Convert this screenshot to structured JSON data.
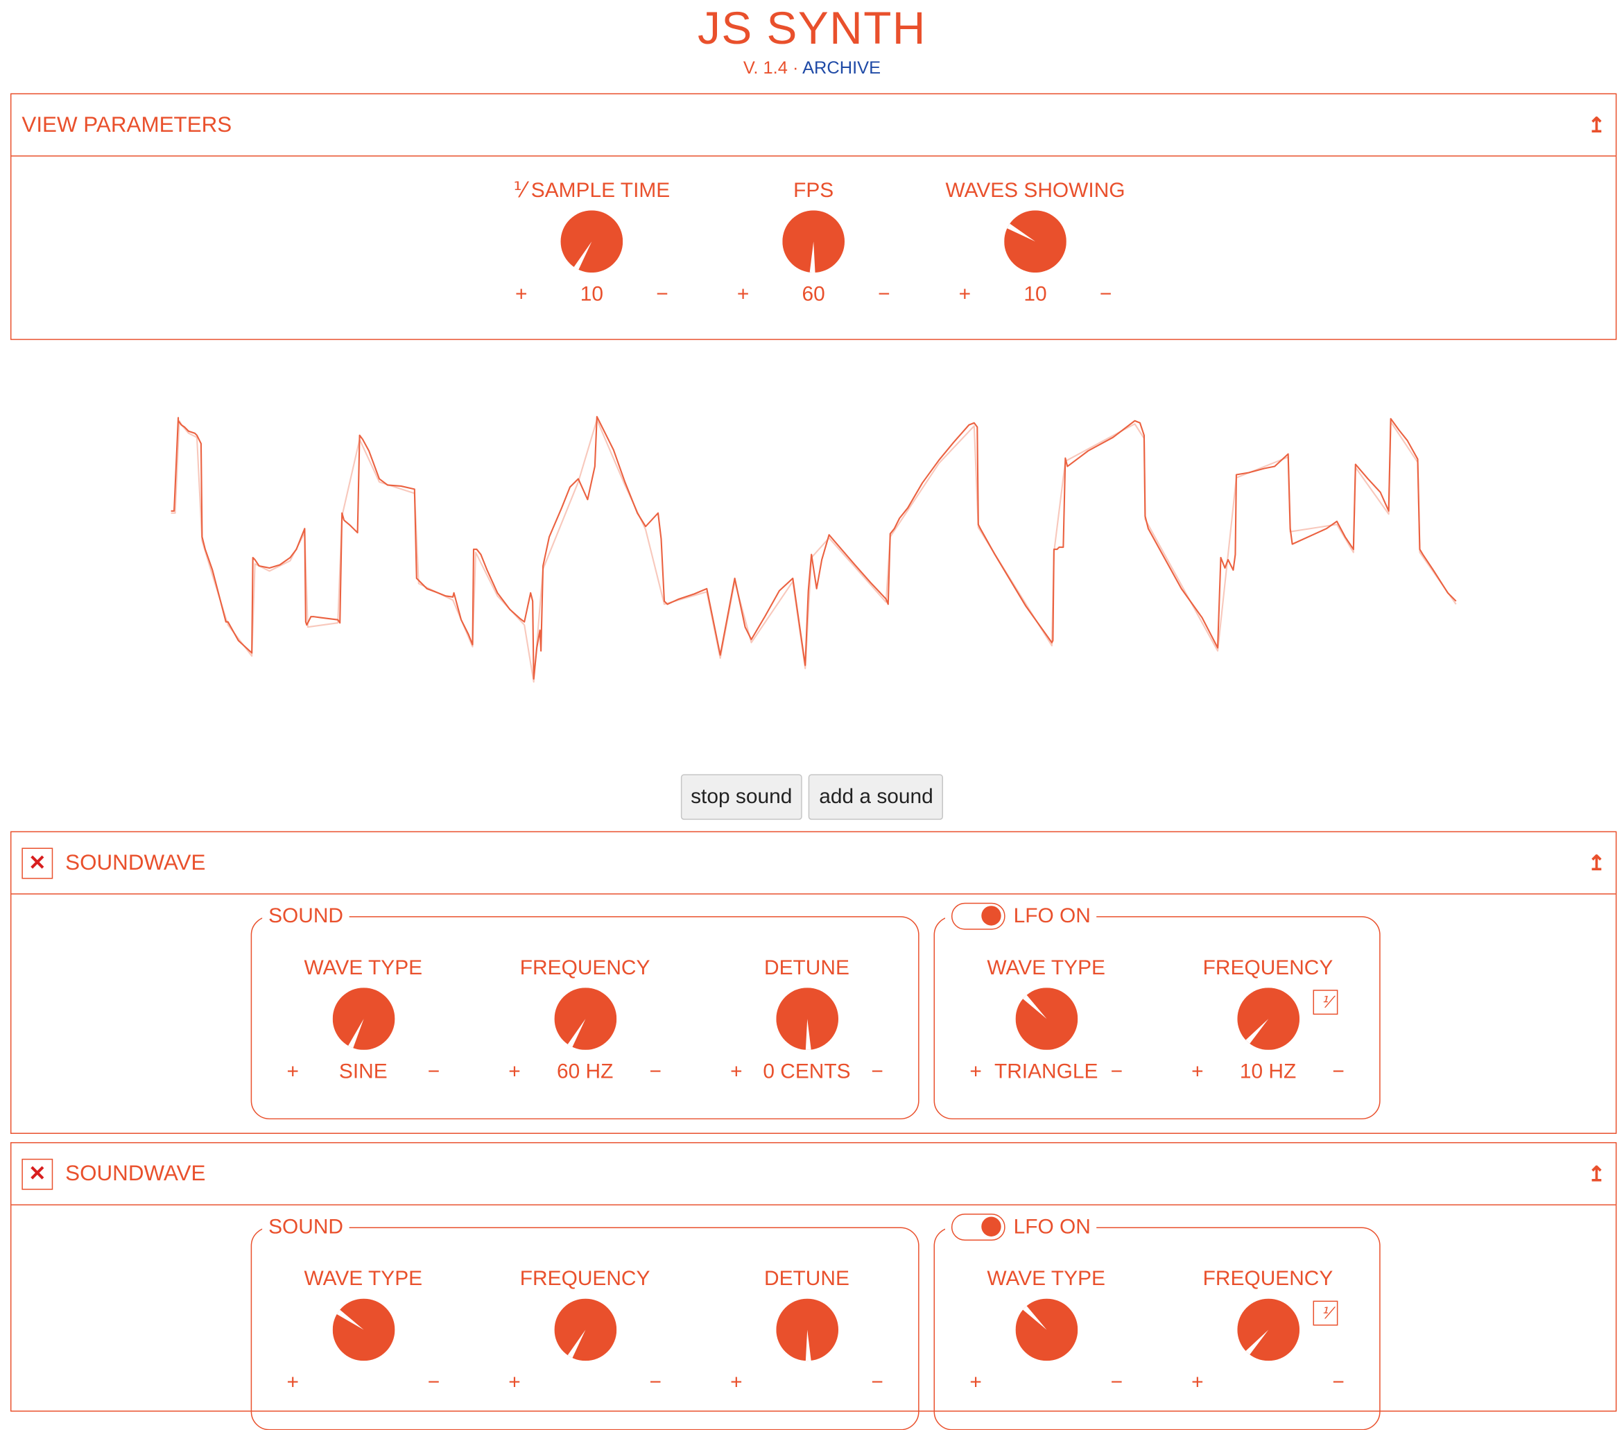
{
  "header": {
    "title": "JS SYNTH",
    "version": "V. 1.4",
    "separator": "·",
    "archive": "ARCHIVE"
  },
  "view_parameters": {
    "title": "VIEW PARAMETERS",
    "collapse_icon": "↥",
    "knobs": [
      {
        "label": "⅟ SAMPLE TIME",
        "value": "10",
        "plus": "+",
        "minus": "−",
        "angle": 210
      },
      {
        "label": "FPS",
        "value": "60",
        "plus": "+",
        "minus": "−",
        "angle": 182
      },
      {
        "label": "WAVES SHOWING",
        "value": "10",
        "plus": "+",
        "minus": "−",
        "angle": 300
      }
    ]
  },
  "controls": {
    "stop": "stop sound",
    "add": "add a sound"
  },
  "soundwaves": [
    {
      "title": "SOUNDWAVE",
      "close_icon": "✕",
      "collapse_icon": "↥",
      "sound": {
        "legend": "SOUND",
        "knobs": [
          {
            "label": "WAVE TYPE",
            "value": "SINE",
            "plus": "+",
            "minus": "−",
            "angle": 205
          },
          {
            "label": "FREQUENCY",
            "value": "60 HZ",
            "plus": "+",
            "minus": "−",
            "angle": 210
          },
          {
            "label": "DETUNE",
            "value": "0 CENTS",
            "plus": "+",
            "minus": "−",
            "angle": 178
          }
        ]
      },
      "lfo": {
        "legend": "LFO ON",
        "reciprocal": "⅟",
        "knobs": [
          {
            "label": "WAVE TYPE",
            "value": "TRIANGLE",
            "plus": "+",
            "minus": "−",
            "angle": 315
          },
          {
            "label": "FREQUENCY",
            "value": "10 HZ",
            "plus": "+",
            "minus": "−",
            "angle": 222
          }
        ]
      }
    },
    {
      "title": "SOUNDWAVE",
      "close_icon": "✕",
      "collapse_icon": "↥",
      "sound": {
        "legend": "SOUND",
        "knobs": [
          {
            "label": "WAVE TYPE",
            "value": "",
            "plus": "+",
            "minus": "−",
            "angle": 305
          },
          {
            "label": "FREQUENCY",
            "value": "",
            "plus": "+",
            "minus": "−",
            "angle": 210
          },
          {
            "label": "DETUNE",
            "value": "",
            "plus": "+",
            "minus": "−",
            "angle": 178
          }
        ]
      },
      "lfo": {
        "legend": "LFO ON",
        "reciprocal": "⅟",
        "knobs": [
          {
            "label": "WAVE TYPE",
            "value": "",
            "plus": "+",
            "minus": "−",
            "angle": 315
          },
          {
            "label": "FREQUENCY",
            "value": "",
            "plus": "+",
            "minus": "−",
            "angle": 222
          }
        ]
      }
    }
  ],
  "colors": {
    "accent": "#e9502c",
    "link": "#1f4aa6",
    "close": "#d81e1e"
  }
}
